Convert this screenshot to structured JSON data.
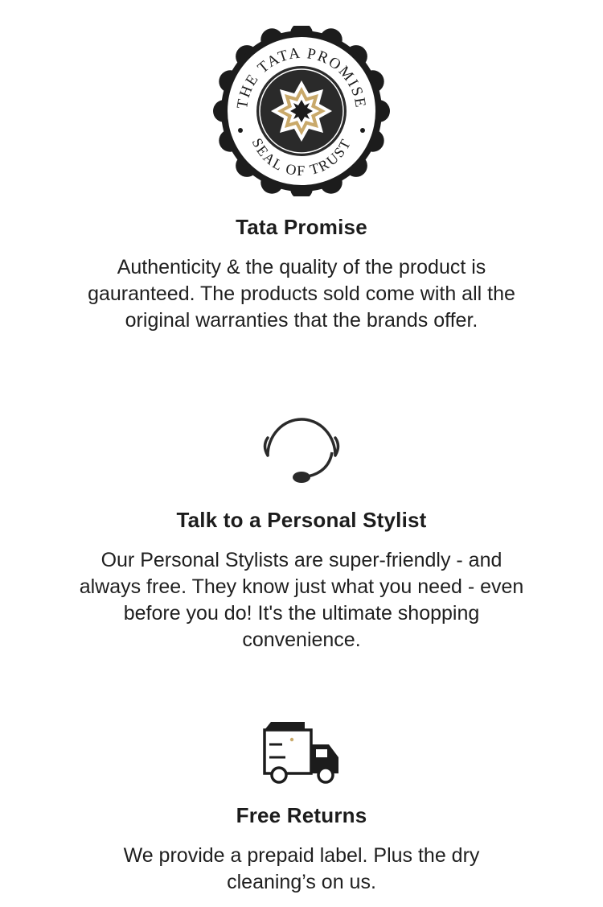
{
  "features": [
    {
      "icon": "seal-of-trust-icon",
      "seal_text_top": "THE TATA PROMISE",
      "seal_text_bottom": "SEAL OF TRUST",
      "title": "Tata Promise",
      "description": "Authenticity & the quality of the product is gauranteed. The products sold come with all the original warranties that the brands offer."
    },
    {
      "icon": "headset-icon",
      "title": "Talk to a Personal Stylist",
      "description": "Our Personal Stylists are super-friendly - and always free. They know just what you need - even before you do! It's the ultimate shopping convenience."
    },
    {
      "icon": "delivery-truck-icon",
      "title": "Free Returns",
      "description": "We provide a prepaid label. Plus the dry cleaning’s on us."
    }
  ],
  "colors": {
    "ink": "#1c1c1c",
    "gold": "#c9a96a",
    "seal_center": "#2a2a2a"
  }
}
